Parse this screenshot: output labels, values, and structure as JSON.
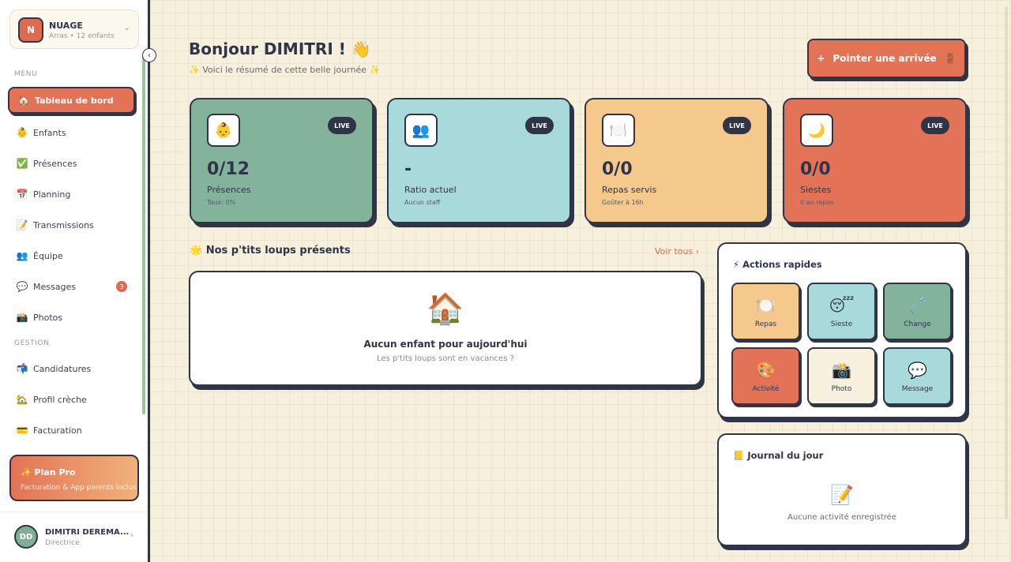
{
  "org": {
    "initial": "N",
    "name": "NUAGE",
    "subtitle": "Arras • 12 enfants"
  },
  "sidebar": {
    "menu_label": "MENU",
    "gestion_label": "GESTION",
    "menu_items": [
      {
        "label": "Tableau de bord",
        "icon": "🏠",
        "icon_name": "home-icon"
      },
      {
        "label": "Enfants",
        "icon": "👶",
        "icon_name": "baby-icon"
      },
      {
        "label": "Présences",
        "icon": "✅",
        "icon_name": "check-icon"
      },
      {
        "label": "Planning",
        "icon": "📅",
        "icon_name": "calendar-icon"
      },
      {
        "label": "Transmissions",
        "icon": "📝",
        "icon_name": "memo-icon"
      },
      {
        "label": "Équipe",
        "icon": "👥",
        "icon_name": "team-icon"
      },
      {
        "label": "Messages",
        "icon": "💬",
        "icon_name": "chat-icon",
        "badge": "3"
      },
      {
        "label": "Photos",
        "icon": "📸",
        "icon_name": "camera-icon"
      }
    ],
    "gestion_items": [
      {
        "label": "Candidatures",
        "icon": "📬",
        "icon_name": "mailbox-icon"
      },
      {
        "label": "Profil crèche",
        "icon": "🏡",
        "icon_name": "house-icon"
      },
      {
        "label": "Facturation",
        "icon": "💳",
        "icon_name": "card-icon"
      }
    ],
    "plan": {
      "title": "Plan Pro",
      "subtitle": "Facturation & App parents inclus"
    },
    "user": {
      "initials": "DD",
      "name": "DIMITRI DEREMA...",
      "role": "Directrice"
    }
  },
  "header": {
    "title": "Bonjour DIMITRI ! 👋",
    "subtitle": "✨ Voici le résumé de cette belle journée ✨",
    "checkin_label": "Pointer une arrivée",
    "checkin_plus": "+",
    "checkin_emoji": "🚪"
  },
  "stats": [
    {
      "icon": "👶",
      "icon_name": "baby-icon",
      "live": "LIVE",
      "value": "0/12",
      "label": "Présences",
      "sub": "Taux: 0%",
      "color": "#83b39a"
    },
    {
      "icon": "👥",
      "icon_name": "team-icon",
      "live": "LIVE",
      "value": "-",
      "label": "Ratio actuel",
      "sub": "Aucun staff",
      "color": "#a8dadc"
    },
    {
      "icon": "🍽️",
      "icon_name": "plate-icon",
      "live": "LIVE",
      "value": "0/0",
      "label": "Repas servis",
      "sub": "Goûter à 16h",
      "color": "#f5c98c"
    },
    {
      "icon": "🌙",
      "icon_name": "moon-icon",
      "live": "LIVE",
      "value": "0/0",
      "label": "Siestes",
      "sub": "0 au repos",
      "color": "#e37356"
    }
  ],
  "kids_section": {
    "title": "🌟 Nos p'tits loups présents",
    "see_all": "Voir tous ›",
    "empty_icon": "🏠",
    "empty_title": "Aucun enfant pour aujourd'hui",
    "empty_sub": "Les p'tits loups sont en vacances ?"
  },
  "quick_actions": {
    "title": "⚡ Actions rapides",
    "items": [
      {
        "label": "Repas",
        "icon": "🍽️",
        "icon_name": "plate-icon",
        "color": "#f5c98c"
      },
      {
        "label": "Sieste",
        "icon": "😴",
        "icon_name": "sleep-icon",
        "color": "#a8dadc"
      },
      {
        "label": "Change",
        "icon": "🧷",
        "icon_name": "pin-icon",
        "color": "#83b39a"
      },
      {
        "label": "Activité",
        "icon": "🎨",
        "icon_name": "palette-icon",
        "color": "#e37356"
      },
      {
        "label": "Photo",
        "icon": "📸",
        "icon_name": "camera-icon",
        "color": "#f6f0dc"
      },
      {
        "label": "Message",
        "icon": "💬",
        "icon_name": "chat-icon",
        "color": "#a8dadc"
      }
    ]
  },
  "journal": {
    "title": "📒 Journal du jour",
    "icon": "📝",
    "empty": "Aucune activité enregistrée"
  },
  "collapse_icon": "‹",
  "chevron_down": "⌄",
  "chevron_right": "›",
  "plan_icon": "✨"
}
